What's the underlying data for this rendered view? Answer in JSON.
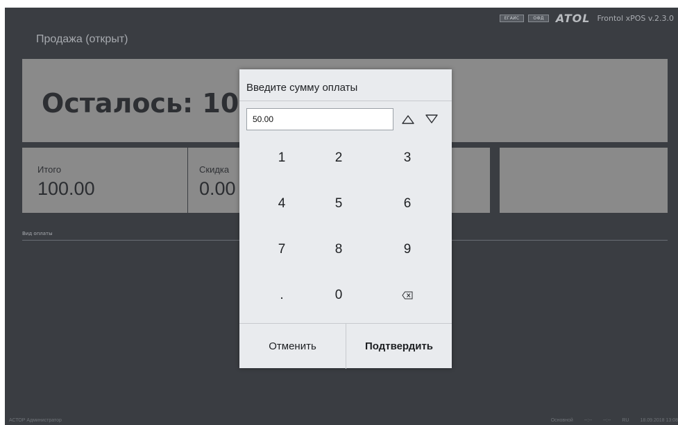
{
  "topbar": {
    "badge_egais": "ЕГАИС",
    "badge_ofd": "ОФД",
    "logo": "ATOL",
    "version": "Frontol xPOS v.2.3.0"
  },
  "window_title": "Продажа (открыт)",
  "remaining": {
    "label": "Осталось: 10"
  },
  "tiles": {
    "total_label": "Итого",
    "total_value": "100.00",
    "discount_label": "Скидка",
    "discount_value": "0.00"
  },
  "payment": {
    "header": "Вид оплаты"
  },
  "status": {
    "left": "АСТОР  Администратор",
    "mode": "Основной",
    "time1": "--:--",
    "time2": "--:--",
    "lang": "RU",
    "datetime": "18.09.2018 13:08"
  },
  "dialog": {
    "title": "Введите сумму оплаты",
    "amount": "50.00",
    "keys": [
      "1",
      "2",
      "3",
      "4",
      "5",
      "6",
      "7",
      "8",
      "9",
      ".",
      "0"
    ],
    "cancel_label": "Отменить",
    "confirm_label": "Подтвердить"
  },
  "icons": {
    "arrow_up": "chevron-up-icon",
    "arrow_down": "chevron-down-icon",
    "backspace": "backspace-icon"
  },
  "colors": {
    "background": "#3a3d42",
    "panel": "#8a8a8a",
    "dialog": "#e9ebee"
  }
}
